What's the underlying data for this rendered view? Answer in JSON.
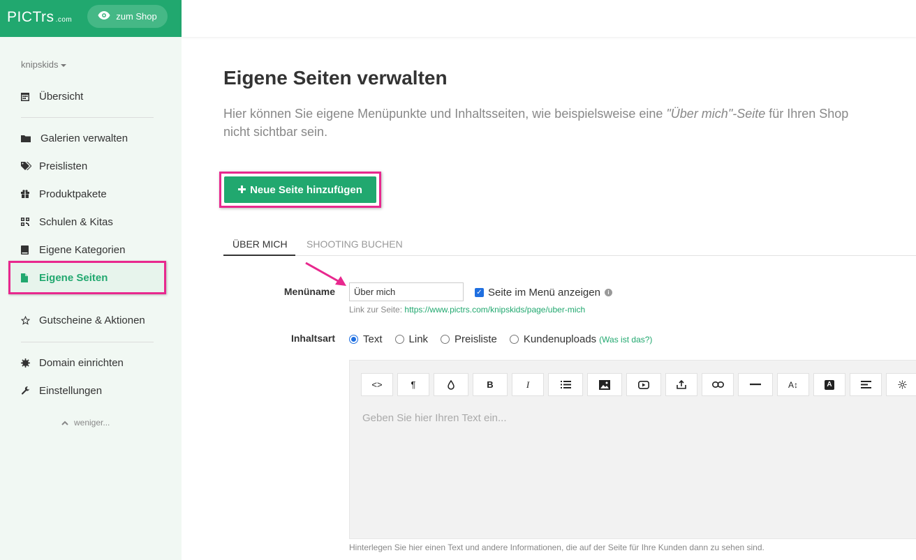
{
  "brand": {
    "logo_text": "PICTrs",
    "logo_suffix": ".com",
    "shop_button": "zum Shop",
    "color": "#21a86f"
  },
  "sidebar": {
    "account": "knipskids",
    "items": [
      {
        "label": "Übersicht",
        "icon": "calendar-icon"
      },
      {
        "label": "Galerien verwalten",
        "icon": "folder-icon"
      },
      {
        "label": "Preislisten",
        "icon": "tags-icon"
      },
      {
        "label": "Produktpakete",
        "icon": "gift-icon"
      },
      {
        "label": "Schulen & Kitas",
        "icon": "qrcode-icon"
      },
      {
        "label": "Eigene Kategorien",
        "icon": "book-icon"
      },
      {
        "label": "Eigene Seiten",
        "icon": "file-icon",
        "active": true
      },
      {
        "label": "Gutscheine & Aktionen",
        "icon": "star-icon"
      },
      {
        "label": "Domain einrichten",
        "icon": "cog-icon"
      },
      {
        "label": "Einstellungen",
        "icon": "wrench-icon"
      }
    ],
    "less": "weniger..."
  },
  "main": {
    "title": "Eigene Seiten verwalten",
    "intro_before": "Hier können Sie eigene Menüpunkte und Inhaltsseiten, wie beispielsweise eine ",
    "intro_em": "\"Über mich\"-Seite",
    "intro_after": " für Ihren Shop",
    "intro_line2": "nicht sichtbar sein.",
    "add_button": "Neue Seite hinzufügen",
    "tabs": [
      {
        "label": "ÜBER MICH",
        "active": true
      },
      {
        "label": "SHOOTING BUCHEN",
        "active": false
      }
    ],
    "form": {
      "menu_name_label": "Menüname",
      "menu_name_value": "Über mich",
      "show_in_menu_label": "Seite im Menü anzeigen",
      "show_in_menu_checked": true,
      "link_prefix": "Link zur Seite:",
      "link_url": "https://www.pictrs.com/knipskids/page/uber-mich",
      "content_type_label": "Inhaltsart",
      "content_types": [
        "Text",
        "Link",
        "Preisliste",
        "Kundenuploads"
      ],
      "content_type_selected": "Text",
      "help_link": "(Was ist das?)"
    },
    "editor": {
      "toolbar": [
        "code-icon",
        "paragraph-icon",
        "color-drop-icon",
        "bold-icon",
        "italic-icon",
        "list-icon",
        "image-icon",
        "video-icon",
        "upload-icon",
        "link-icon",
        "horizontal-rule-icon",
        "font-size-icon",
        "font-color-icon",
        "align-icon",
        "settings-icon"
      ],
      "toolbar_text": {
        "code": "<>",
        "paragraph": "¶",
        "bold": "B",
        "italic": "I",
        "font_size": "A↕",
        "font_color": "A"
      },
      "placeholder": "Geben Sie hier Ihren Text ein...",
      "hint": "Hinterlegen Sie hier einen Text und andere Informationen, die auf der Seite für Ihre Kunden dann zu sehen sind."
    }
  },
  "highlight_color": "#e8288e"
}
